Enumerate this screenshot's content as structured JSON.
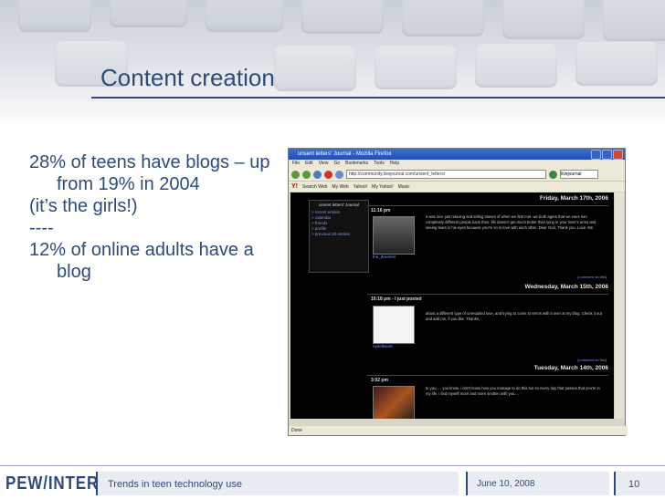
{
  "slide": {
    "title": "Content creation",
    "bullets": [
      "28% of teens have blogs – up from 19% in 2004",
      "(it’s the girls!)",
      "----",
      "12% of online adults have a blog"
    ]
  },
  "browser": {
    "window_title": "unsent letters' Journal - Mozilla Firefox",
    "menu": [
      "File",
      "Edit",
      "View",
      "Go",
      "Bookmarks",
      "Tools",
      "Help"
    ],
    "url": "http://community.livejournal.com/unsent_letters/",
    "search_placeholder": "livejournal",
    "toolbar_items": [
      "Search Web",
      "My Web",
      "Yahoo!",
      "My Yahoo!",
      "Music"
    ],
    "status": "Done",
    "journal": {
      "sidebar_title": "unsent letters' Journal",
      "sidebar_links": [
        "> recent entries",
        "> calendar",
        "> friends",
        "> profile",
        "> previous 20 entries"
      ],
      "entries": [
        {
          "date": "Friday, March 17th, 2006",
          "time": "11:16 pm",
          "user": "the_dreamer",
          "text": "it was nice just relaxing and telling stories of when we first met. we both agree that we were two completely different people back then. life doesn't get much better than lying in your lover's arms and seeing tears in his eyes because you're so in love with each other. Dear God, Thank you. Love, Me",
          "comment": "[comment on this]"
        },
        {
          "date": "Wednesday, March 15th, 2006",
          "time": "10:18 pm - I just posted",
          "user": "nydelkarah",
          "text": "about a different type of unrequited love, and trying to come to terms with it over at my blog. Check it out and add me, if you like. Thanks,",
          "comment": "[comment on this]"
        },
        {
          "date": "Tuesday, March 14th, 2006",
          "time": "3:02 pm",
          "user": "",
          "text": "to you..... you know, i don't know how you manage to do this but so every day that passes that you're in my life, i find myself more and more smitten with you....",
          "comment": ""
        }
      ]
    }
  },
  "footer": {
    "logo": "PEW/INTERNET",
    "caption": "Trends in teen technology use",
    "date": "June 10, 2008",
    "page_number": "10"
  },
  "colors": {
    "title": "#2f4a7a",
    "bullet_text": "#2c4a82",
    "journal_bg": "#000000"
  }
}
